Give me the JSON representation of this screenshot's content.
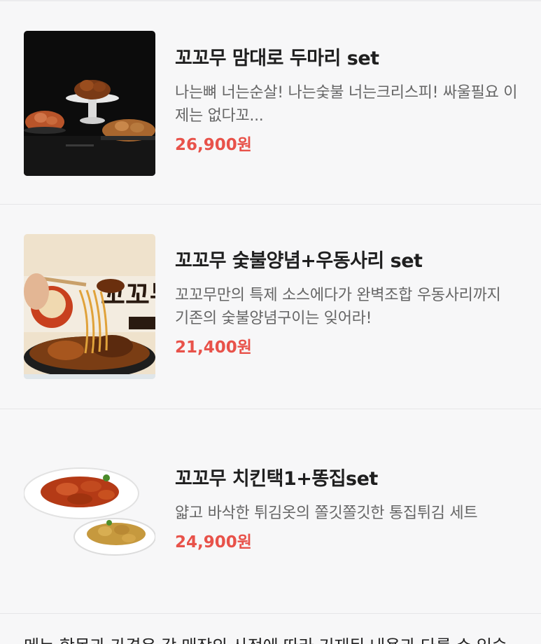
{
  "menu": {
    "items": [
      {
        "title": "꼬꼬무 맘대로 두마리 set",
        "description": "나는뼈 너는순살! 나는숯불 너는크리스피! 싸울필요 이제는 없다꼬...",
        "price": "26,900원",
        "image_icon": "chicken-platter-dark-image"
      },
      {
        "title": "꼬꼬무 숯불양념+우동사리 set",
        "description": "꼬꼬무만의 특제 소스에다가 완벽조합 우동사리까지 기존의 숯불양념구이는 잊어라!",
        "price": "21,400원",
        "image_icon": "udon-chicken-image",
        "image_text": "꼬꼬무"
      },
      {
        "title": "꼬꼬무 치킨택1+똥집set",
        "description": "얇고 바삭한 튀김옷의 쫄깃쫄깃한 통집튀김 세트",
        "price": "24,900원",
        "image_icon": "chicken-gizzard-plates-image"
      }
    ]
  },
  "notice": {
    "text": "메뉴 항목과 가격은 각 매장의 사정에 따라 기재된 내용과 다를 수 있습"
  },
  "colors": {
    "price": "#e8524a",
    "background": "#f7f7f8"
  }
}
